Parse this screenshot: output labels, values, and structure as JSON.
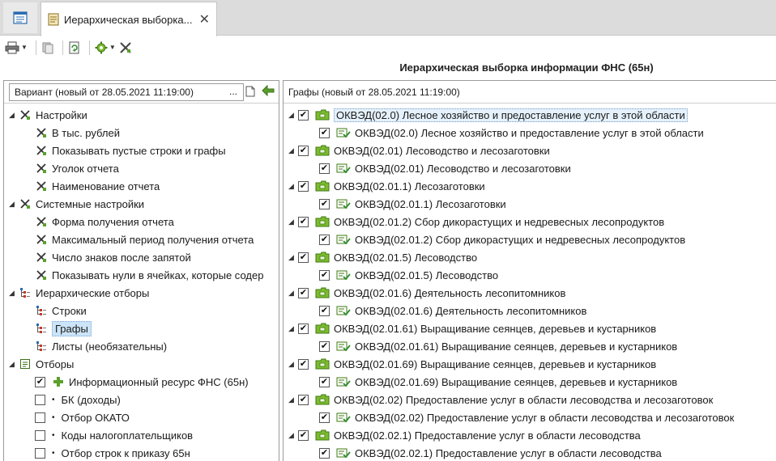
{
  "tabs": {
    "document_tab_label": "Иерархическая выборка...",
    "close_glyph": "✕"
  },
  "report_title": "Иерархическая выборка информации ФНС (65н)",
  "left": {
    "variant_value": "Вариант (новый от 28.05.2021 11:19:00)",
    "variant_ellipsis": "...",
    "tree": [
      {
        "label": "Настройки",
        "level": 0,
        "icon": "tools-icon",
        "expanded": true
      },
      {
        "label": "В тыс. рублей",
        "level": 1,
        "icon": "tools-icon"
      },
      {
        "label": "Показывать пустые строки и графы",
        "level": 1,
        "icon": "tools-icon"
      },
      {
        "label": "Уголок отчета",
        "level": 1,
        "icon": "tools-icon"
      },
      {
        "label": "Наименование отчета",
        "level": 1,
        "icon": "tools-icon"
      },
      {
        "label": "Системные настройки",
        "level": 0,
        "icon": "tools-icon",
        "expanded": true
      },
      {
        "label": "Форма получения отчета",
        "level": 1,
        "icon": "tools-icon"
      },
      {
        "label": "Максимальный период получения отчета",
        "level": 1,
        "icon": "tools-icon"
      },
      {
        "label": "Число знаков после запятой",
        "level": 1,
        "icon": "tools-icon"
      },
      {
        "label": "Показывать нули в ячейках, которые содер",
        "level": 1,
        "icon": "tools-icon"
      },
      {
        "label": "Иерархические отборы",
        "level": 0,
        "icon": "hierarchy-icon",
        "expanded": true
      },
      {
        "label": "Строки",
        "level": 1,
        "icon": "hierarchy-icon"
      },
      {
        "label": "Графы",
        "level": 1,
        "icon": "hierarchy-icon",
        "selected": true
      },
      {
        "label": "Листы (необязательны)",
        "level": 1,
        "icon": "hierarchy-icon"
      },
      {
        "label": "Отборы",
        "level": 0,
        "icon": "filter-list-icon",
        "expanded": true
      },
      {
        "label": "Информационный ресурс ФНС (65н)",
        "level": 1,
        "icon": "plus-icon",
        "checkbox": true,
        "checked": true
      },
      {
        "label": "БК (доходы)",
        "level": 1,
        "icon": "bullet",
        "checkbox": true,
        "checked": false
      },
      {
        "label": "Отбор ОКАТО",
        "level": 1,
        "icon": "bullet",
        "checkbox": true,
        "checked": false
      },
      {
        "label": "Коды налогоплательщиков",
        "level": 1,
        "icon": "bullet",
        "checkbox": true,
        "checked": false
      },
      {
        "label": "Отбор строк к приказу 65н",
        "level": 1,
        "icon": "bullet",
        "checkbox": true,
        "checked": false
      }
    ]
  },
  "right": {
    "header": "Графы (новый от 28.05.2021 11:19:00)",
    "tree": [
      {
        "label": "ОКВЭД(02.0) Лесное хозяйство и предоставление услуг в этой области",
        "level": 0,
        "checked": true,
        "highlighted": true
      },
      {
        "label": "ОКВЭД(02.0) Лесное хозяйство и предоставление услуг в этой области",
        "level": 1,
        "checked": true
      },
      {
        "label": "ОКВЭД(02.01) Лесоводство и лесозаготовки",
        "level": 0,
        "checked": true
      },
      {
        "label": "ОКВЭД(02.01) Лесоводство и лесозаготовки",
        "level": 1,
        "checked": true
      },
      {
        "label": "ОКВЭД(02.01.1) Лесозаготовки",
        "level": 0,
        "checked": true
      },
      {
        "label": "ОКВЭД(02.01.1) Лесозаготовки",
        "level": 1,
        "checked": true
      },
      {
        "label": "ОКВЭД(02.01.2) Сбор дикорастущих и недревесных лесопродуктов",
        "level": 0,
        "checked": true
      },
      {
        "label": "ОКВЭД(02.01.2) Сбор дикорастущих и недревесных лесопродуктов",
        "level": 1,
        "checked": true
      },
      {
        "label": "ОКВЭД(02.01.5) Лесоводство",
        "level": 0,
        "checked": true
      },
      {
        "label": "ОКВЭД(02.01.5) Лесоводство",
        "level": 1,
        "checked": true
      },
      {
        "label": "ОКВЭД(02.01.6) Деятельность лесопитомников",
        "level": 0,
        "checked": true
      },
      {
        "label": "ОКВЭД(02.01.6) Деятельность лесопитомников",
        "level": 1,
        "checked": true
      },
      {
        "label": "ОКВЭД(02.01.61) Выращивание сеянцев, деревьев и кустарников",
        "level": 0,
        "checked": true
      },
      {
        "label": "ОКВЭД(02.01.61) Выращивание сеянцев, деревьев и кустарников",
        "level": 1,
        "checked": true
      },
      {
        "label": "ОКВЭД(02.01.69) Выращивание сеянцев, деревьев и кустарников",
        "level": 0,
        "checked": true
      },
      {
        "label": "ОКВЭД(02.01.69) Выращивание сеянцев, деревьев и кустарников",
        "level": 1,
        "checked": true
      },
      {
        "label": "ОКВЭД(02.02) Предоставление услуг в области лесоводства и лесозаготовок",
        "level": 0,
        "checked": true
      },
      {
        "label": "ОКВЭД(02.02) Предоставление услуг в области лесоводства и лесозаготовок",
        "level": 1,
        "checked": true
      },
      {
        "label": "ОКВЭД(02.02.1) Предоставление услуг в области лесоводства",
        "level": 0,
        "checked": true
      },
      {
        "label": "ОКВЭД(02.02.1) Предоставление услуг в области лесоводства",
        "level": 1,
        "checked": true
      }
    ]
  }
}
